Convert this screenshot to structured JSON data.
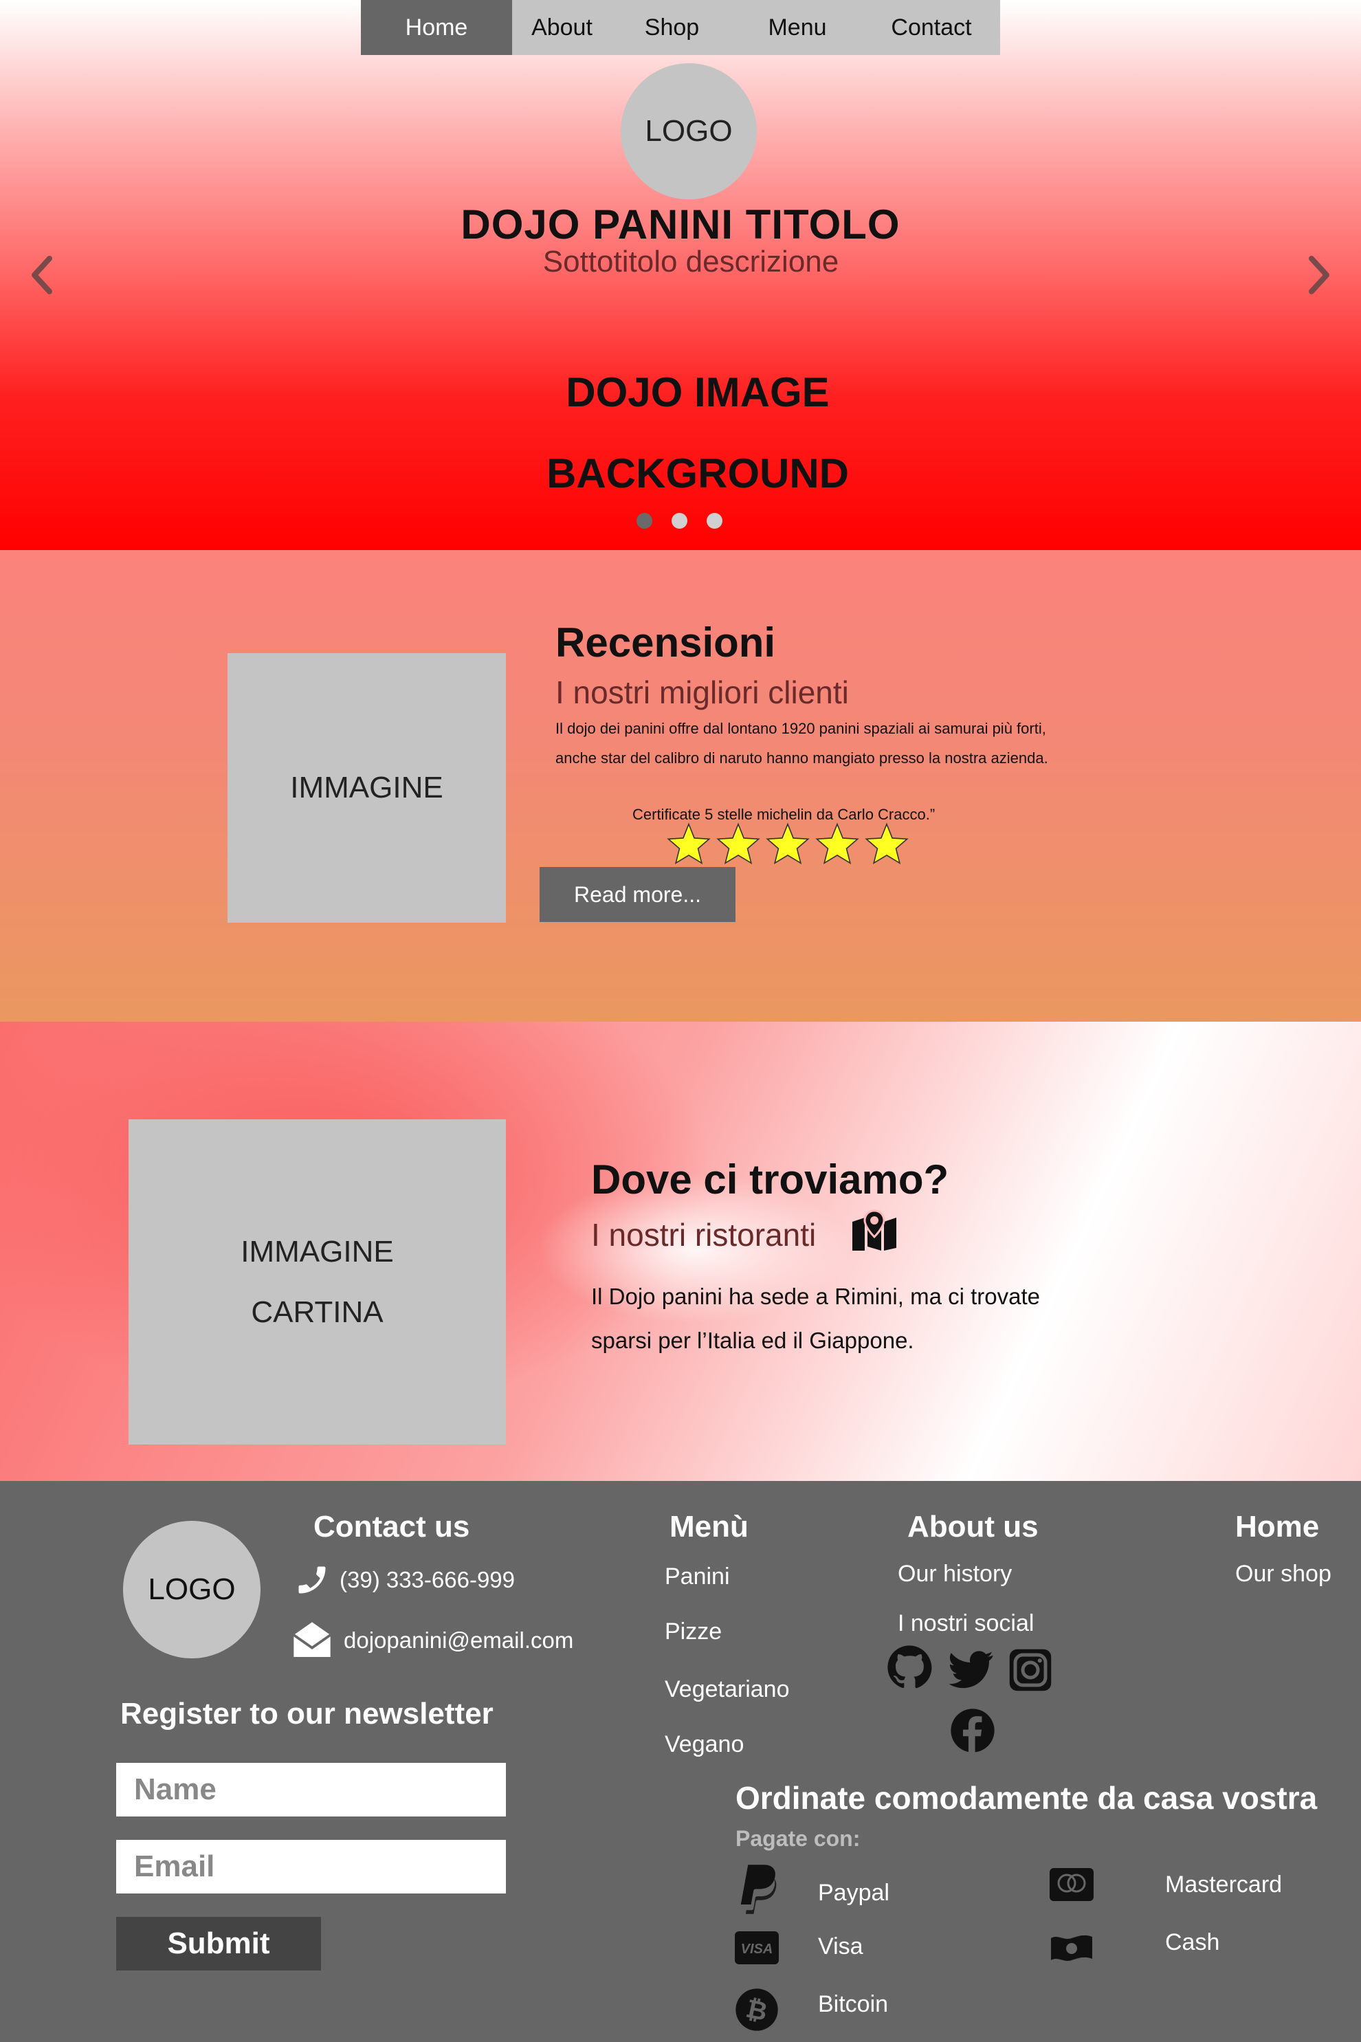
{
  "nav": {
    "items": [
      {
        "label": "Home",
        "active": true
      },
      {
        "label": "About",
        "active": false
      },
      {
        "label": "Shop",
        "active": false
      },
      {
        "label": "Menu",
        "active": false
      },
      {
        "label": "Contact",
        "active": false
      }
    ]
  },
  "hero": {
    "logo": "LOGO",
    "title": "DOJO PANINI TITOLO",
    "subtitle": "Sottotitolo descrizione",
    "bg_line1": "DOJO IMAGE",
    "bg_line2": "BACKGROUND",
    "carousel_active_index": 0,
    "carousel_count": 3,
    "icons": [
      "chevron-left-icon",
      "chevron-right-icon"
    ]
  },
  "reviews": {
    "image_label": "IMMAGINE",
    "title": "Recensioni",
    "subtitle": "I nostri migliori clienti",
    "text": "Il dojo dei panini offre dal lontano 1920 panini spaziali ai samurai più forti, anche star del calibro di naruto hanno mangiato presso la nostra azienda.",
    "certificate": "Certificate 5 stelle michelin da Carlo Cracco.”",
    "rating": 5,
    "star_color": "#ffff22",
    "read_more": "Read more..."
  },
  "location": {
    "image_line1": "IMMAGINE",
    "image_line2": "CARTINA",
    "title": "Dove ci troviamo?",
    "subtitle": "I nostri ristoranti",
    "text": "Il Dojo panini ha sede a Rimini, ma ci trovate sparsi per l’Italia ed il Giappone.",
    "icon": "map-marker-icon"
  },
  "footer": {
    "logo": "LOGO",
    "contact": {
      "title": "Contact us",
      "phone": "(39) 333-666-999",
      "email": "dojopanini@email.com"
    },
    "menu": {
      "title": "Menù",
      "items": [
        "Panini",
        "Pizze",
        "Vegetariano",
        "Vegano"
      ]
    },
    "about": {
      "title": "About us",
      "items": [
        "Our history",
        "I nostri social"
      ],
      "socials": [
        "github-icon",
        "twitter-icon",
        "instagram-icon",
        "facebook-icon"
      ]
    },
    "home": {
      "title": "Home",
      "items": [
        "Our shop"
      ]
    },
    "newsletter": {
      "title": "Register to our newsletter",
      "name_placeholder": "Name",
      "email_placeholder": "Email",
      "submit": "Submit"
    },
    "order": {
      "title": "Ordinate comodamente da casa vostra",
      "pay_with": "Pagate con:",
      "methods": [
        "Paypal",
        "Visa",
        "Bitcoin",
        "Mastercard",
        "Cash"
      ]
    }
  },
  "colors": {
    "nav_bg": "#c4c4c4",
    "nav_active": "#666666",
    "footer_bg": "#666666",
    "button_bg": "#666666",
    "placeholder_bg": "#c4c4c4"
  }
}
